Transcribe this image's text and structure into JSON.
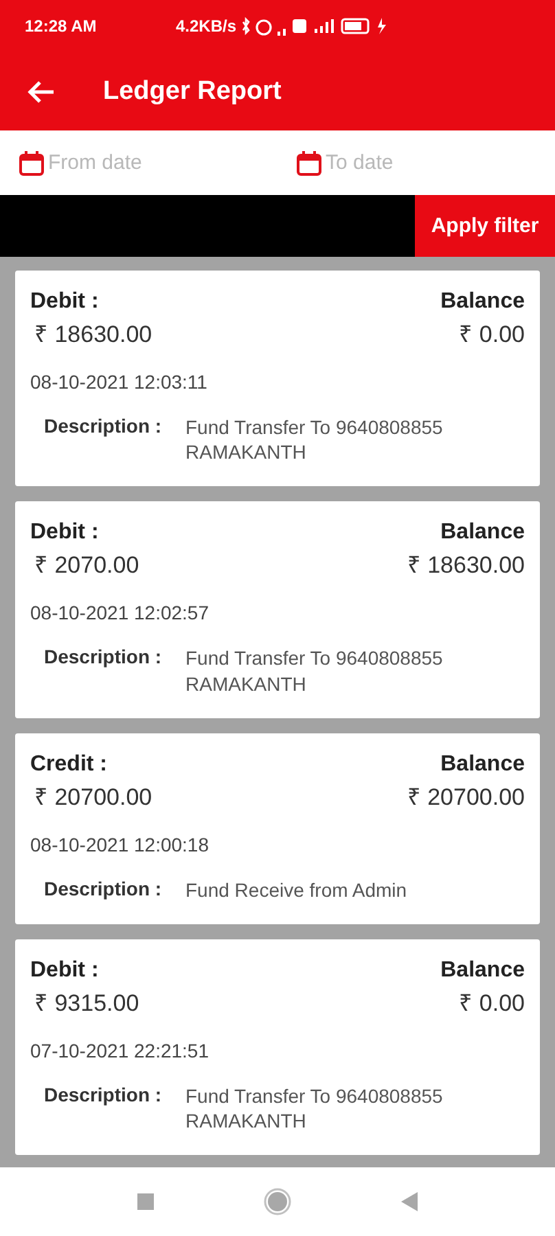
{
  "status_bar": {
    "time": "12:28 AM",
    "speed": "4.2KB/s"
  },
  "toolbar": {
    "title": "Ledger Report"
  },
  "filters": {
    "from": {
      "placeholder": "From date"
    },
    "to": {
      "placeholder": "To date"
    },
    "apply": "Apply filter"
  },
  "entries": [
    {
      "type_label": "Debit :",
      "amount": "₹ 18630.00",
      "balance_label": "Balance",
      "balance": "₹ 0.00",
      "datetime": "08-10-2021 12:03:11",
      "description_label": "Description :",
      "description": "Fund Transfer To 9640808855 RAMAKANTH"
    },
    {
      "type_label": "Debit :",
      "amount": "₹ 2070.00",
      "balance_label": "Balance",
      "balance": "₹ 18630.00",
      "datetime": "08-10-2021 12:02:57",
      "description_label": "Description :",
      "description": "Fund Transfer To 9640808855 RAMAKANTH"
    },
    {
      "type_label": "Credit :",
      "amount": "₹ 20700.00",
      "balance_label": "Balance",
      "balance": "₹ 20700.00",
      "datetime": "08-10-2021 12:00:18",
      "description_label": "Description :",
      "description": "Fund Receive from Admin"
    },
    {
      "type_label": "Debit :",
      "amount": "₹ 9315.00",
      "balance_label": "Balance",
      "balance": "₹ 0.00",
      "datetime": "07-10-2021 22:21:51",
      "description_label": "Description :",
      "description": "Fund Transfer To 9640808855 RAMAKANTH"
    }
  ]
}
